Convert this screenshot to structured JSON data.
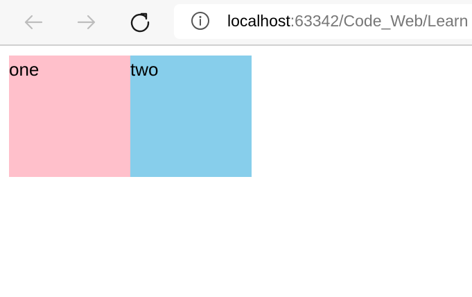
{
  "browser": {
    "icons": {
      "back": "arrow-left-icon",
      "forward": "arrow-right-icon",
      "reload": "reload-icon",
      "info": "info-icon"
    },
    "address": {
      "host": "localhost",
      "rest": ":63342/Code_Web/Learn"
    }
  },
  "page": {
    "boxes": [
      {
        "label": "one",
        "color": "#ffc0cb"
      },
      {
        "label": "two",
        "color": "#87ceeb"
      }
    ]
  }
}
